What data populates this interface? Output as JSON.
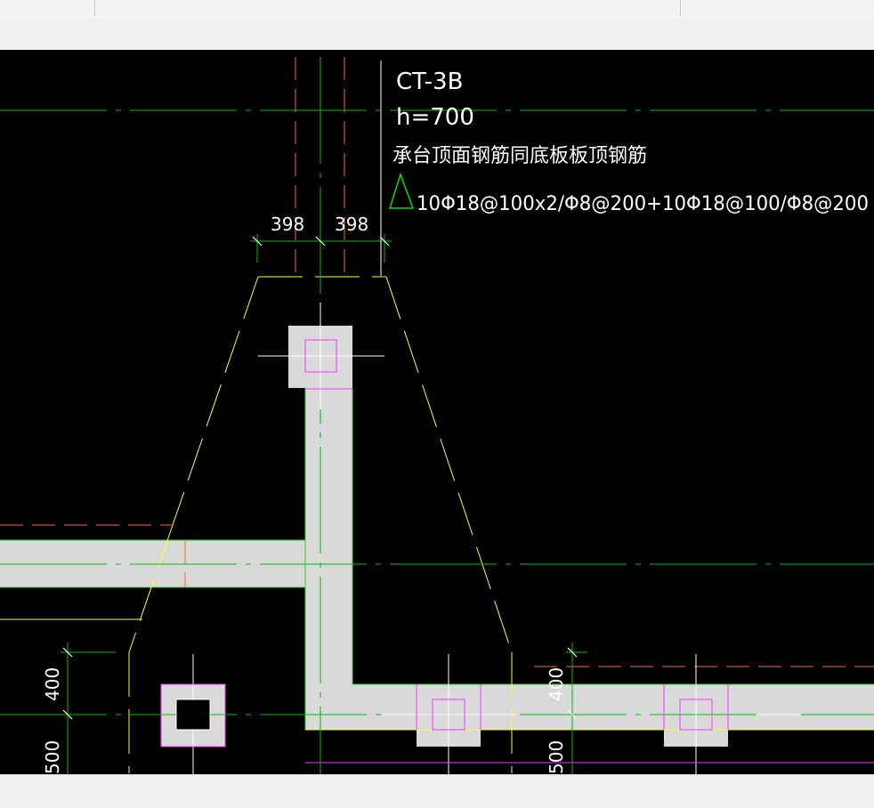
{
  "toolbar": {
    "items": [
      {
        "label": ""
      },
      {
        "label": ""
      },
      {
        "label": ""
      },
      {
        "label": ""
      },
      {
        "label": ""
      },
      {
        "label": ""
      },
      {
        "label": ""
      },
      {
        "label": ""
      },
      {
        "label": ""
      },
      {
        "label": ""
      },
      {
        "label": ""
      }
    ]
  },
  "drawing": {
    "cap_label": "CT-3B",
    "height_label": "h=700",
    "note": "承台顶面钢筋同底板板顶钢筋",
    "rebar_spec": "10Φ18@100x2/Φ8@200+10Φ18@100/Φ8@200",
    "dim_top_left": "398",
    "dim_top_right": "398",
    "dim_left_400": "400",
    "dim_left_500": "500",
    "dim_mid_400": "400",
    "dim_mid_500": "500"
  },
  "colors": {
    "canvas_bg": "#000000",
    "wall_fill": "#d9d9d9",
    "axis_line": "#00c000",
    "dash_line": "#ffff33",
    "column_outline": "#ff33ff",
    "hidden_line": "#ff6633",
    "text": "#ffffff"
  }
}
